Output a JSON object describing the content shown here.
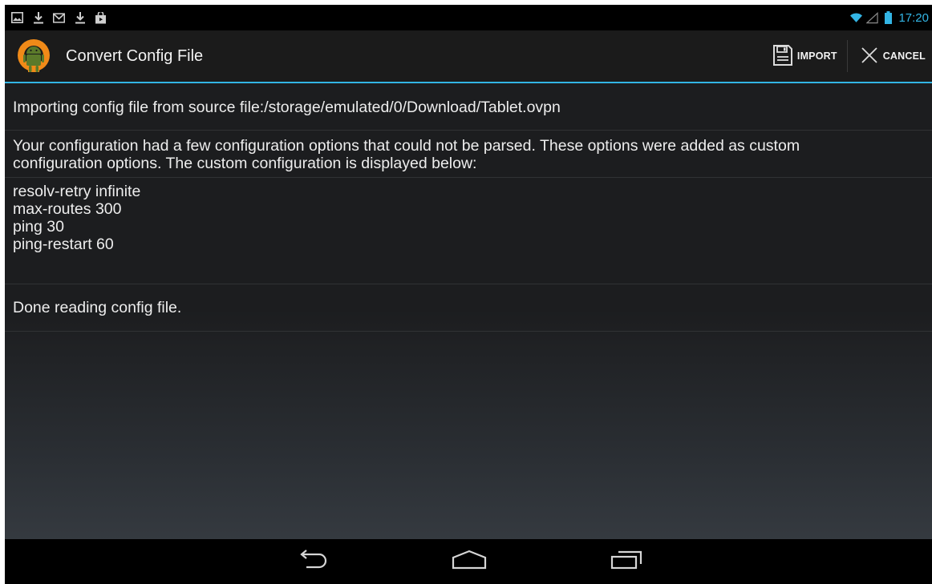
{
  "status_bar": {
    "notification_icons": [
      "gallery-icon",
      "download-icon",
      "gmail-icon",
      "download-icon",
      "store-icon"
    ],
    "system_icons": [
      "wifi-icon",
      "signal-icon",
      "battery-icon"
    ],
    "time": "17:20"
  },
  "action_bar": {
    "title": "Convert Config File",
    "import_label": "IMPORT",
    "cancel_label": "CANCEL"
  },
  "content": {
    "source_line": "Importing config file from source file:/storage/emulated/0/Download/Tablet.ovpn",
    "warning_lines": [
      "Your configuration had a few configuration options that could not be parsed. These options were added as custom",
      "configuration options. The custom configuration is displayed below:"
    ],
    "custom_options": [
      "resolv-retry infinite",
      "max-routes 300",
      "ping 30",
      "ping-restart 60"
    ],
    "done_line": "Done reading config file."
  },
  "nav_bar": {
    "buttons": [
      "back-icon",
      "home-icon",
      "recents-icon"
    ]
  },
  "colors": {
    "accent": "#33b5e5",
    "logo_orange": "#f08a18",
    "android_green": "#5b7a2a"
  }
}
